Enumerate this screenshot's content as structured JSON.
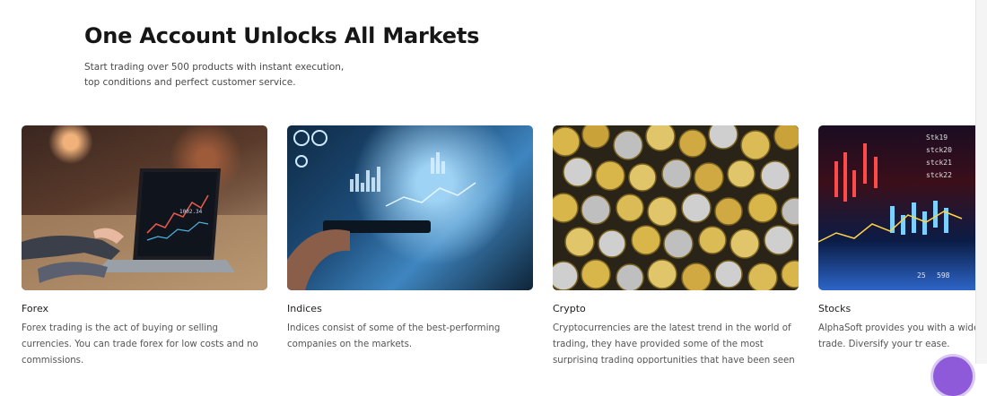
{
  "section": {
    "title": "One Account Unlocks All Markets",
    "subtitle_line1": "Start trading over 500 products with instant execution,",
    "subtitle_line2": "top conditions and perfect customer service."
  },
  "cards": [
    {
      "title": "Forex",
      "description": "Forex trading is the act of buying or selling currencies. You can trade forex for low costs and no commissions.",
      "image": "laptop-trading-chart-photo"
    },
    {
      "title": "Indices",
      "description": "Indices consist of some of the best-performing companies on the markets.",
      "image": "tablet-holographic-data-photo"
    },
    {
      "title": "Crypto",
      "description": "Cryptocurrencies are the latest trend in the world of trading, they have provided some of the most surprising trading opportunities that have been seen over the last",
      "image": "crypto-coins-photo"
    },
    {
      "title": "Stocks",
      "description": "AlphaSoft provides you with a wide se stocks you can trade. Diversify your tr ease.",
      "image": "stock-ticker-candlestick-photo"
    }
  ],
  "colors": {
    "fab": "#8e5ad9"
  },
  "icons": [
    "chat-fab-icon"
  ]
}
